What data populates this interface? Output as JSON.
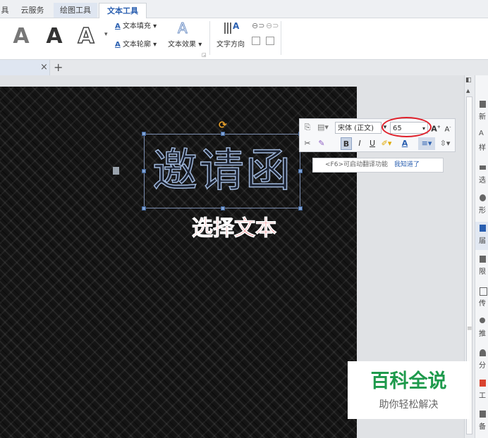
{
  "tabs": [
    {
      "label": "具"
    },
    {
      "label": "云服务"
    },
    {
      "label": "绘图工具"
    },
    {
      "label": "文本工具"
    }
  ],
  "ribbon": {
    "big_a": "A",
    "text_fill": "文本填充",
    "text_outline": "文本轮廓",
    "text_effect": "文本效果",
    "text_direction": "文字方向"
  },
  "doc_tabs": {
    "close": "×",
    "add": "+"
  },
  "slide": {
    "title_text": "邀请函",
    "annotation": "选择文本"
  },
  "mini_toolbar": {
    "font_name": "宋体 (正文)",
    "font_size": "65",
    "bold": "B",
    "italic": "I",
    "underline": "U",
    "font_color": "A",
    "tip_text": "<F6>可启动翻译功能",
    "tip_link": "我知道了"
  },
  "right_panel": {
    "items": [
      {
        "label": "新"
      },
      {
        "label": "样"
      },
      {
        "label": "选"
      },
      {
        "label": "形"
      },
      {
        "label": "届"
      },
      {
        "label": "限"
      },
      {
        "label": "传"
      },
      {
        "label": "推"
      },
      {
        "label": "分"
      },
      {
        "label": "工"
      },
      {
        "label": "备"
      }
    ]
  },
  "watermark": {
    "title": "百科全说",
    "subtitle": "助你轻松解决"
  },
  "colors": {
    "accent": "#2a5fb0",
    "annotation_red": "#e4141b",
    "watermark_green": "#1e9a4c"
  }
}
